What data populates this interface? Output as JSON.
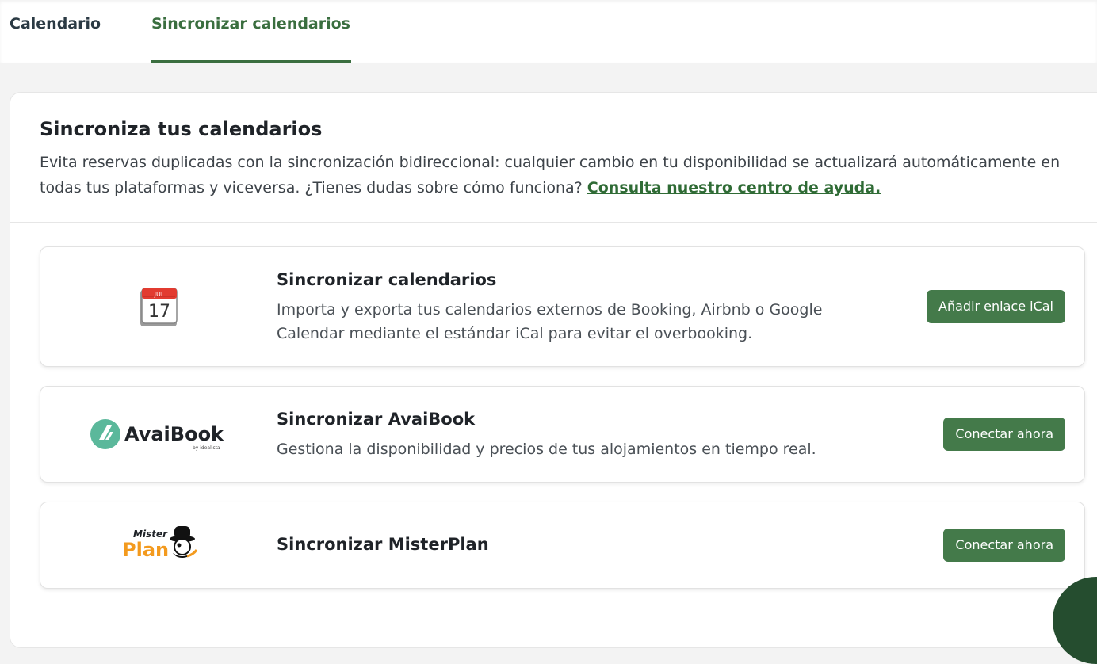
{
  "tabs": {
    "calendar": "Calendario",
    "sync": "Sincronizar calendarios"
  },
  "panel": {
    "title": "Sincroniza tus calendarios",
    "desc": "Evita reservas duplicadas con la sincronización bidireccional: cualquier cambio en tu disponibilidad se actualizará automáticamente en todas tus plataformas y viceversa. ¿Tienes dudas sobre cómo funciona?",
    "help_link": "Consulta nuestro centro de ayuda."
  },
  "cards": [
    {
      "title": "Sincronizar calendarios",
      "desc": "Importa y exporta tus calendarios externos de Booking, Airbnb o Google Calendar mediante el estándar iCal para evitar el overbooking.",
      "button": "Añadir enlace iCal",
      "logo": {
        "month": "JUL",
        "day": "17",
        "icon": "calendar-icon"
      }
    },
    {
      "title": "Sincronizar AvaiBook",
      "desc": "Gestiona la disponibilidad y precios de tus alojamientos en tiempo real.",
      "button": "Conectar ahora",
      "logo": {
        "name": "AvaiBook",
        "sub": "by idealista"
      }
    },
    {
      "title": "Sincronizar MisterPlan",
      "button": "Conectar ahora",
      "logo": {
        "top": "Mister",
        "main": "Plan"
      }
    }
  ],
  "colors": {
    "accent": "#3a6e3f",
    "button": "#447a4a",
    "avaibook": "#5bb89b",
    "misterplan": "#f39a1e"
  }
}
